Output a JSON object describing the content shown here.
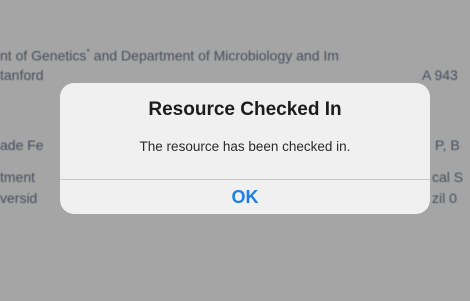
{
  "background_document": {
    "lines": [
      "nt of Genetics",
      "tanford",
      "ade Fe",
      "tment",
      "versid"
    ],
    "line0_sup": "*",
    "line0_tail": " and Department of Microbiology and Im",
    "line1_tail": "A 943",
    "line2_tail": "P, B",
    "line3_tail": "cal S",
    "line4_tail": "zil 0"
  },
  "alert": {
    "title": "Resource Checked In",
    "message": "The resource has been checked in.",
    "ok_label": "OK"
  },
  "colors": {
    "ok_text": "#1f7ee3",
    "dim_overlay": "rgba(40,40,40,0.42)",
    "alert_bg": "#f3f3f3"
  }
}
